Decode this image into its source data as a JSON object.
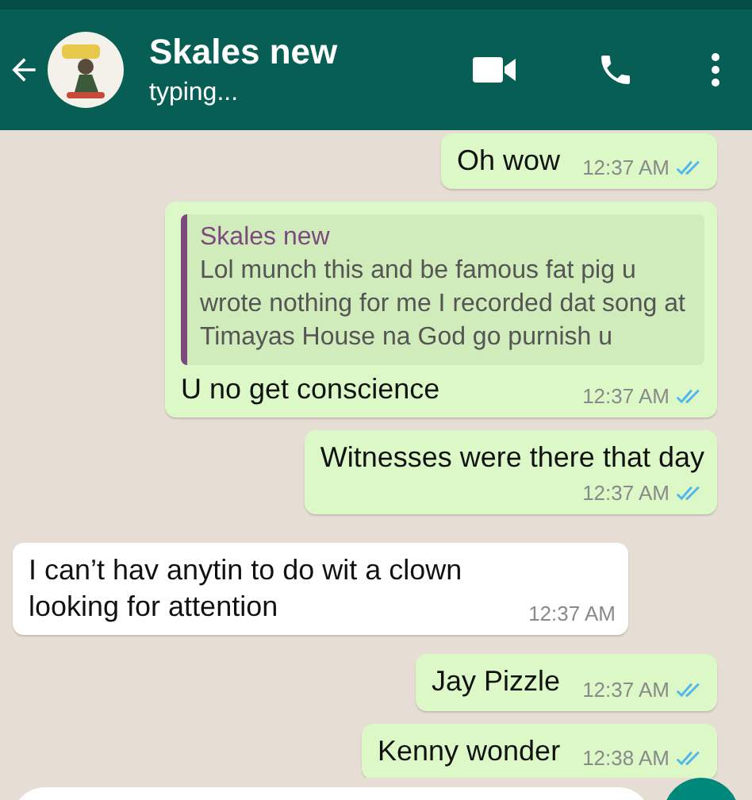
{
  "header": {
    "title": "Skales new",
    "status": "typing..."
  },
  "messages": [
    {
      "outgoing": true,
      "text": "Oh wow",
      "time": "12:37 AM",
      "read": true
    },
    {
      "outgoing": true,
      "quote": {
        "author": "Skales new",
        "text": "Lol munch this and be famous fat pig u wrote nothing for me I recorded dat song at Timayas House na God go purnish u"
      },
      "text": "U no get conscience",
      "time": "12:37 AM",
      "read": true
    },
    {
      "outgoing": true,
      "text": "Witnesses were there that day",
      "time": "12:37 AM",
      "read": true,
      "time_below": true
    },
    {
      "outgoing": false,
      "text": "I can’t hav anytin to do wit a clown looking for attention",
      "time": "12:37 AM"
    },
    {
      "outgoing": true,
      "text": "Jay Pizzle",
      "time": "12:37 AM",
      "read": true
    },
    {
      "outgoing": true,
      "text": "Kenny wonder",
      "time": "12:38 AM",
      "read": true
    }
  ]
}
